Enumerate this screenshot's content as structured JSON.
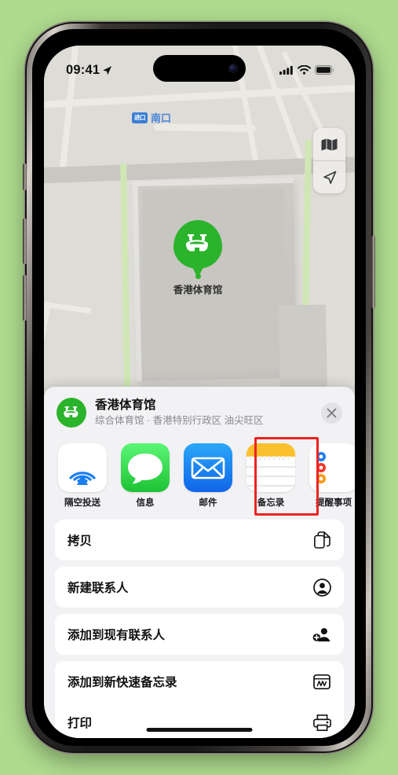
{
  "background_color": "#aedb8e",
  "status_bar": {
    "time": "09:41",
    "location_icon": "location-arrow-icon",
    "cellular_icon": "cellular-bars-icon",
    "wifi_icon": "wifi-icon",
    "battery_icon": "battery-full-icon"
  },
  "map": {
    "label_south_gate": {
      "badge": "进口",
      "text": "南口"
    },
    "pin": {
      "label": "香港体育馆",
      "color": "#2cb32c",
      "icon": "stadium-icon"
    },
    "controls": [
      {
        "name": "map-type-button",
        "icon": "folded-map-icon"
      },
      {
        "name": "locate-me-button",
        "icon": "location-arrow-icon"
      }
    ]
  },
  "share_sheet": {
    "title": "香港体育馆",
    "subtitle": "综合体育馆 · 香港特别行政区 油尖旺区",
    "avatar_icon": "stadium-icon",
    "close_label": "✕",
    "apps": [
      {
        "label": "隔空投送",
        "icon": "airdrop-icon",
        "highlighted": false
      },
      {
        "label": "信息",
        "icon": "messages-icon",
        "highlighted": false
      },
      {
        "label": "邮件",
        "icon": "mail-icon",
        "highlighted": false
      },
      {
        "label": "备忘录",
        "icon": "notes-icon",
        "highlighted": true
      },
      {
        "label": "提醒事项",
        "icon": "reminders-icon",
        "highlighted": false
      }
    ],
    "highlight_color": "#ee2222",
    "actions": [
      {
        "label": "拷贝",
        "icon": "copy-icon"
      },
      {
        "label": "新建联系人",
        "icon": "person-circle-icon"
      },
      {
        "label": "添加到现有联系人",
        "icon": "person-add-icon"
      },
      {
        "label": "添加到新快速备忘录",
        "icon": "quick-note-icon"
      },
      {
        "label": "打印",
        "icon": "printer-icon"
      }
    ]
  }
}
